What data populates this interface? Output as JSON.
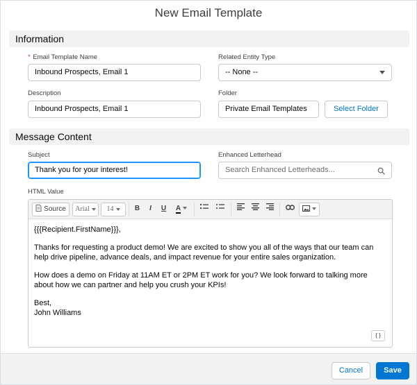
{
  "modal": {
    "title": "New Email Template"
  },
  "sections": {
    "information": "Information",
    "message_content": "Message Content"
  },
  "fields": {
    "template_name": {
      "label": "Email Template Name",
      "required_mark": "*",
      "value": "Inbound Prospects, Email 1"
    },
    "related_entity": {
      "label": "Related Entity Type",
      "value": "-- None --"
    },
    "description": {
      "label": "Description",
      "value": "Inbound Prospects, Email 1"
    },
    "folder": {
      "label": "Folder",
      "value": "Private Email Templates",
      "button": "Select Folder"
    },
    "subject": {
      "label": "Subject",
      "value": "Thank you for your interest!"
    },
    "letterhead": {
      "label": "Enhanced Letterhead",
      "placeholder": "Search Enhanced Letterheads..."
    },
    "html_value": {
      "label": "HTML Value"
    }
  },
  "toolbar": {
    "source": "Source",
    "font": "Arial",
    "size": "14",
    "bold": "B",
    "italic": "I",
    "underline": "U",
    "color": "A"
  },
  "editor": {
    "paragraphs": [
      "{{{Recipient.FirstName}}},",
      "Thanks for requesting a product demo! We are excited to show you all of the ways that our team can help drive pipeline, advance deals, and impact revenue for your entire sales organization.",
      "How does a demo on Friday at 11AM ET or 2PM ET work for you? We look forward to talking more about how we can partner and help you crush your KPIs!"
    ],
    "signoff": "Best,",
    "signature": "John Williams",
    "code_button": "{ }"
  },
  "footer": {
    "cancel": "Cancel",
    "save": "Save"
  },
  "colors": {
    "brand": "#0176d3",
    "focus": "#1b96ff",
    "section_bg": "#f3f2f2",
    "required": "#c23934"
  }
}
